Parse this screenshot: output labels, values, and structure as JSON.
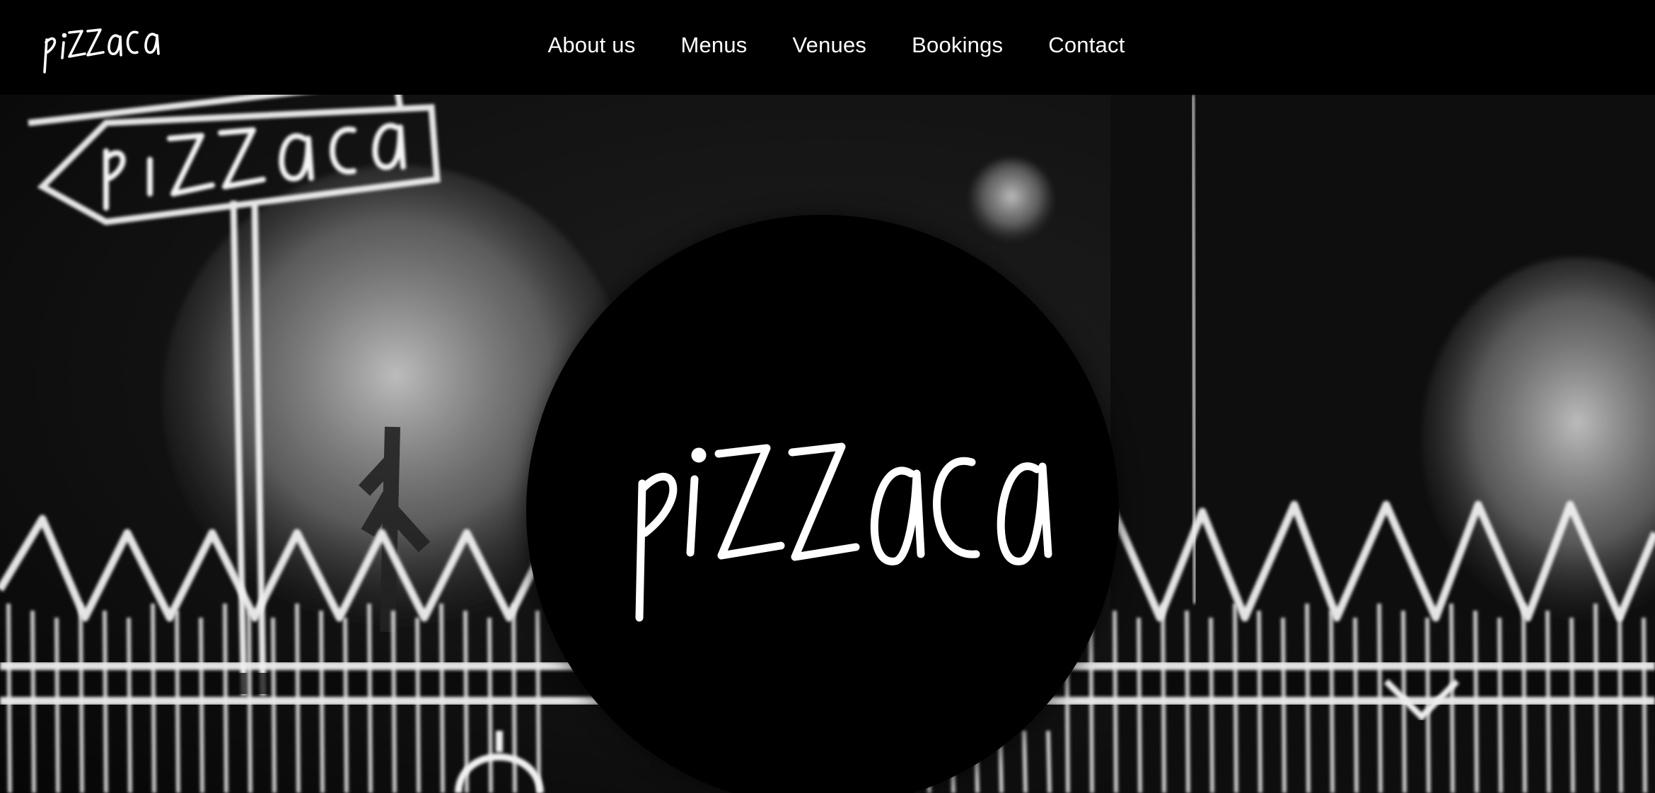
{
  "brand": {
    "name": "pizzaca",
    "logo_icon": "pizzaca-wordmark-logo",
    "primary_color": "#000000",
    "text_color": "#ffffff"
  },
  "nav": {
    "items": [
      {
        "label": "About us"
      },
      {
        "label": "Menus"
      },
      {
        "label": "Venues"
      },
      {
        "label": "Bookings"
      },
      {
        "label": "Contact"
      }
    ]
  },
  "hero": {
    "background_description_icon": "chalkboard-fence-trees-illustration",
    "sign_text": "pizzaca",
    "center_logo_text": "pizzaca"
  }
}
